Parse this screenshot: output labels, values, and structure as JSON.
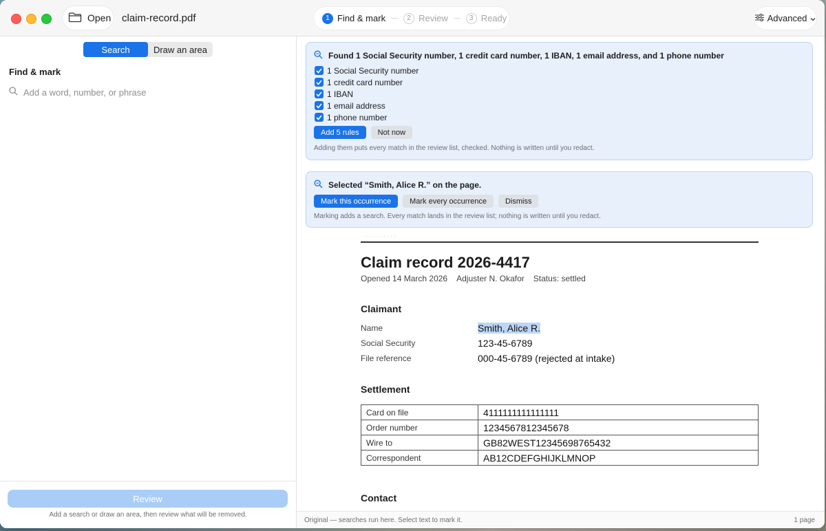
{
  "toolbar": {
    "open_label": "Open",
    "doc_title": "claim-record.pdf",
    "steps": [
      {
        "num": "1",
        "label": "Find & mark"
      },
      {
        "num": "2",
        "label": "Review"
      },
      {
        "num": "3",
        "label": "Ready"
      }
    ],
    "advanced_label": "Advanced"
  },
  "sidebar": {
    "tabs": [
      "Search",
      "Draw an area"
    ],
    "heading": "Find & mark",
    "search_placeholder": "Add a word, number, or phrase",
    "review_label": "Review",
    "hint": "Add a search or draw an area, then review what will be removed."
  },
  "banner1": {
    "title": "Found 1 Social Security number, 1 credit card number, 1 IBAN, 1 email address, and 1 phone number",
    "items": [
      "1 Social Security number",
      "1 credit card number",
      "1 IBAN",
      "1 email address",
      "1 phone number"
    ],
    "primary": "Add 5 rules",
    "secondary": "Not now",
    "note": "Adding them puts every match in the review list, checked. Nothing is written until you redact."
  },
  "banner2": {
    "title": "Selected “Smith, Alice R.” on the page.",
    "primary": "Mark this occurrence",
    "secondary": "Mark every occurrence",
    "dismiss": "Dismiss",
    "note": "Marking adds a search. Every match lands in the review list; nothing is written until you redact."
  },
  "document": {
    "title": "Claim record 2026-4417",
    "meta": [
      "Opened 14 March 2026",
      "Adjuster N. Okafor",
      "Status: settled"
    ],
    "claimant_heading": "Claimant",
    "claimant": [
      {
        "key": "Name",
        "value": "Smith, Alice R."
      },
      {
        "key": "Social Security",
        "value": "123-45-6789"
      },
      {
        "key": "File reference",
        "value": "000-45-6789 (rejected at intake)"
      }
    ],
    "settlement_heading": "Settlement",
    "settlement": [
      {
        "key": "Card on file",
        "value": "4111111111111111"
      },
      {
        "key": "Order number",
        "value": "1234567812345678"
      },
      {
        "key": "Wire to",
        "value": "GB82WEST12345698765432"
      },
      {
        "key": "Correspondent",
        "value": "AB12CDEFGHIJKLMNOP"
      }
    ],
    "contact_heading": "Contact"
  },
  "statusbar": {
    "left": "Original — searches run here. Select text to mark it.",
    "right": "1 page"
  },
  "colors": {
    "accent": "#1a73e8",
    "banner_bg": "#e8f0fc",
    "highlight": "#bcd6f5"
  }
}
